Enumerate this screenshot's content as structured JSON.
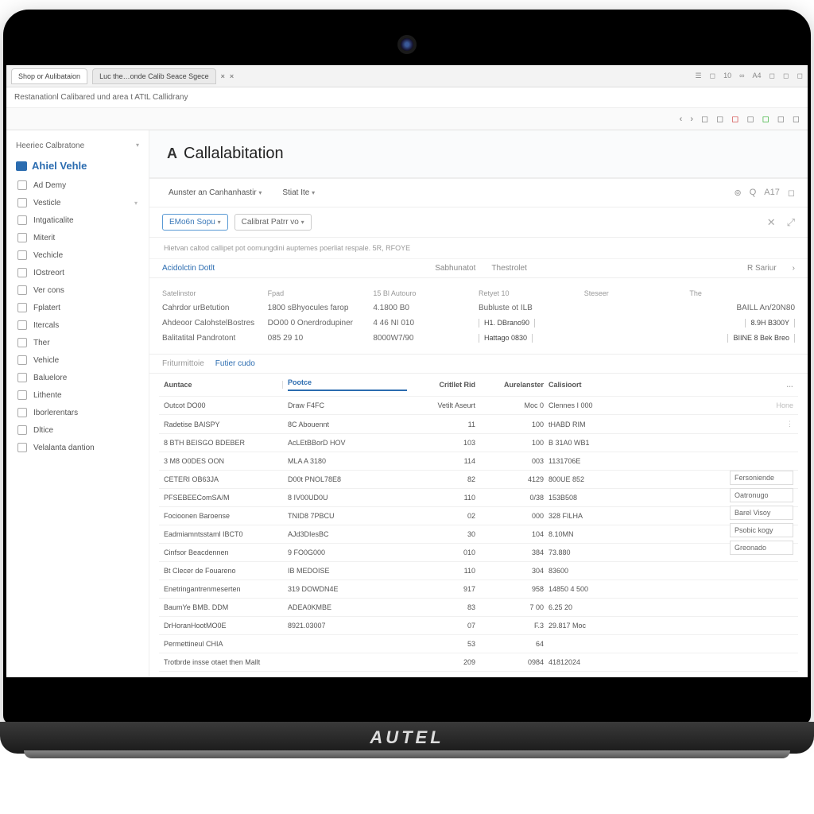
{
  "browser": {
    "tabs": [
      {
        "label": "Shop or Aulibataion"
      },
      {
        "label": "Luc the…onde Calib Seace Sgece"
      }
    ],
    "url": "Restanationl Calibared und area t ATtL Callidrany",
    "icons": [
      "☰",
      "◻",
      "10",
      "∞",
      "A4",
      "◻",
      "◻",
      "◻"
    ],
    "url_icons": [
      "‹",
      "›",
      "◻",
      "◻",
      "|",
      "◻",
      "◻",
      "|",
      "◻",
      "◻",
      "◻"
    ]
  },
  "sidebar": {
    "header": "Heeriec Calbratone",
    "brand": "Ahiel Vehle",
    "items": [
      {
        "icon": "",
        "label": "Ad Demy"
      },
      {
        "icon": "",
        "label": "Vesticle",
        "caret": true
      },
      {
        "icon": "",
        "label": "Intgaticalite"
      },
      {
        "icon": "",
        "label": "Miterit"
      },
      {
        "icon": "",
        "label": "Vechicle"
      },
      {
        "icon": "",
        "label": "IOstreort"
      },
      {
        "icon": "",
        "label": "Ver cons"
      },
      {
        "icon": "",
        "label": "Fplatert"
      },
      {
        "icon": "",
        "label": "Itercals"
      },
      {
        "icon": "",
        "label": "Ther"
      },
      {
        "icon": "",
        "label": "Vehicle"
      },
      {
        "icon": "",
        "label": "Baluelore"
      },
      {
        "icon": "",
        "label": "Lithente"
      },
      {
        "icon": "",
        "label": "Iborlerentars"
      },
      {
        "icon": "",
        "label": "Dltice"
      },
      {
        "icon": "",
        "label": "Velalanta dantion"
      }
    ]
  },
  "page": {
    "title": "Callalabitation",
    "subtabs": [
      {
        "label": "Aunster an Canhanhastir",
        "caret": true
      },
      {
        "label": "Stiat Ite",
        "caret": true
      }
    ],
    "right_icons": [
      "⊚",
      "Q",
      "A17",
      "◻"
    ],
    "filters": [
      {
        "label": "EMo6n Sopu",
        "caret": true
      },
      {
        "label": "Calibrat Patrr vo",
        "caret": true
      }
    ],
    "helper": "Hietvan caltod callipet pot oomungdini auptemes poerliat respale. 5R, RFOYE",
    "topnav": [
      "Acidolctin Dotlt",
      "Sabhunatot",
      "Thestrolet",
      "R Sariur"
    ],
    "summary_headers": [
      "Satelinstor",
      "Fpad",
      "15 Bl Autouro",
      "Retyet  10",
      "Steseer",
      "The"
    ],
    "summary_rows": [
      {
        "c1": "Cahrdor urBetution",
        "c2": "1800 sBhyocules farop",
        "c3": "4.1800 B0",
        "c4": "Bubluste ot ILB",
        "c5": "",
        "c6": "BAILL An/20N80"
      },
      {
        "c1": "Ahdeoor CalohstelBostres",
        "c2": "DO00 0 Onerdrodupiner",
        "c3": "4 46 NI 010",
        "c4": "H1. DBrano90",
        "c5": "",
        "c6": "8.9H B300Y"
      },
      {
        "c1": "Balitatital Pandrotont",
        "c2": "085 29 10",
        "c3": "8000W7/90",
        "c4": "Hattago 0830",
        "c5": "",
        "c6": "BIINE 8 Bek Breo"
      }
    ],
    "minitabs": [
      "Friturmittoie",
      "Futier cudo"
    ],
    "table": {
      "headers": [
        "Auntace",
        "Pootce",
        "Critllet Rid",
        "Aurelanster",
        "Calisioort",
        "…"
      ],
      "row_end": "Hone",
      "rows": [
        {
          "c1": "Outcot DO00",
          "c2": "Draw F4FC",
          "c3": "Vetilt Aseurt",
          "c4": "Moc 0",
          "c5": "Clennes I 000"
        },
        {
          "c1": "Radetise BAISPY",
          "c2": "8C Abouennt",
          "c3": "11",
          "c4": "100",
          "c5": "tHABD RIM"
        },
        {
          "c1": "8 BTH BEISGO BDEBER",
          "c2": "AcLEtBBorD HOV",
          "c3": "103",
          "c4": "100",
          "c5": "B 31A0 WB1"
        },
        {
          "c1": "3 M8 O0DES OON",
          "c2": "MLA A 3180",
          "c3": "114",
          "c4": "003",
          "c5": "1131706E"
        },
        {
          "c1": "CETERI OB63JA",
          "c2": "D00t PNOL78E8",
          "c3": "82",
          "c4": "4129",
          "c5": "800UE 852"
        },
        {
          "c1": "PFSEBEEComSA/M",
          "c2": "8 IV00UD0U",
          "c3": "110",
          "c4": "0/38",
          "c5": "153B508"
        },
        {
          "c1": "Focioonen Baroense",
          "c2": "TNID8 7PBCU",
          "c3": "02",
          "c4": "000",
          "c5": "328 FILHA"
        },
        {
          "c1": "Eadmiamntsstaml IBCT0",
          "c2": "AJd3DIesBC",
          "c3": "30",
          "c4": "104",
          "c5": "8.10MN"
        },
        {
          "c1": "Cinfsor Beacdennen",
          "c2": "9 FO0G000",
          "c3": "010",
          "c4": "384",
          "c5": "73.880"
        },
        {
          "c1": "Bt Clecer de Fouareno",
          "c2": "IB MEDOISE",
          "c3": "110",
          "c4": "304",
          "c5": "83600"
        },
        {
          "c1": "Enetringantrenmeserten",
          "c2": "319 DOWDN4E",
          "c3": "917",
          "c4": "958",
          "c5": "14850 4 500"
        },
        {
          "c1": "BaumYe BMB. DDM",
          "c2": "ADEA0KMBE",
          "c3": "83",
          "c4": "7 00",
          "c5": "6.25 20"
        },
        {
          "c1": "DrHoranHootMO0E",
          "c2": "8921.03007",
          "c3": "07",
          "c4": "F.3",
          "c5": "29.817 Moc"
        },
        {
          "c1": "Permettineul CHIA",
          "c2": "",
          "c3": "53",
          "c4": "64",
          "c5": ""
        },
        {
          "c1": "Trotbrde insse otaet then Mallt",
          "c2": "",
          "c3": "209",
          "c4": "0984",
          "c5": "41812024"
        }
      ]
    },
    "sidepane": [
      "Fersoniende",
      "Oatronugo",
      "Barel Visoy",
      "Psobic kogy",
      "Greonado"
    ]
  },
  "brand": "AUTEL"
}
